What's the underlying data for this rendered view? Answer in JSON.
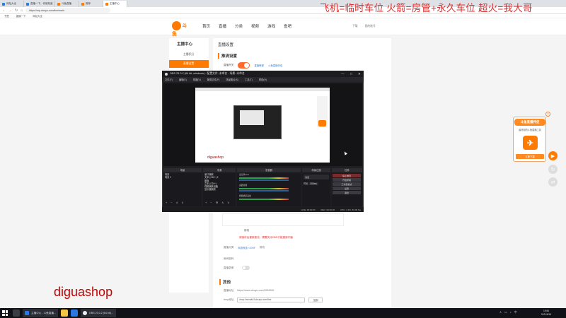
{
  "overlay_text": "飞机=临时车位  火箭=房管+永久车位  超火=我大哥",
  "watermark": "diguashop",
  "browser": {
    "tabs": [
      {
        "label": "网站大全",
        "active": false
      },
      {
        "label": "直播一下，你就知道",
        "active": false
      },
      {
        "label": "斗鱼直播",
        "active": false
      },
      {
        "label": "推荐",
        "active": false
      },
      {
        "label": "主播中心",
        "active": true
      }
    ],
    "url": "https://mp.douyu.com/live/main",
    "bookmarks": [
      "书签",
      "直播一下",
      "网站大全"
    ]
  },
  "site": {
    "logo_text": "斗鱼",
    "nav": [
      "首页",
      "直播",
      "分类",
      "视频",
      "游戏",
      "鱼吧"
    ],
    "user_links": [
      "下载",
      "我的账号"
    ]
  },
  "sidebar": {
    "title": "主播中心",
    "items": [
      {
        "label": "主播积分",
        "active": false
      },
      {
        "label": "直播设置",
        "active": true
      }
    ]
  },
  "main": {
    "title": "直播设置",
    "section_live": "推流设置",
    "open_label": "直播开关",
    "open_on": true,
    "link_tutorial": "直播教程",
    "link_tool": "斗鱼直播伴侣",
    "edit_button": "修改",
    "red_note": "请保存后重新推流，需要关闭OBS才能重新开播",
    "category_label": "直播分类",
    "category_value": "网游竞技>>DNF",
    "category_change": "修改",
    "password_label": "房间密码",
    "record_label": "直播录像",
    "section_other": "其他",
    "room_addr_label": "直播地址",
    "room_addr_value": "https://www.douyu.com/9999999",
    "rtmp_label": "rtmp地址",
    "rtmp_value": "rtmp://sendtc3.douyu.com/live",
    "copy_label": "复制"
  },
  "ad": {
    "title": "斗鱼直播伴侣",
    "subtitle": "最好用的斗鱼直播工具",
    "logo_glyph": "✈",
    "button": "立即下载"
  },
  "obs": {
    "title": "OBS 23.0.2 (64 bit, windows) - 配置文件: 未命名 - 场景: 未命名",
    "window_controls": [
      "—",
      "□",
      "✕"
    ],
    "menu": [
      "文件(F)",
      "编辑(E)",
      "视图(V)",
      "配置文件(P)",
      "场景集合(S)",
      "工具(T)",
      "帮助(H)"
    ],
    "inner_watermark": "diguashop",
    "docks": {
      "scenes": {
        "title": "场景",
        "items": [
          "场景",
          "场景 2"
        ]
      },
      "sources": {
        "title": "来源",
        "items": [
          "窗口捕获",
          "文本 (GDI+) 2",
          "图像",
          "文本 (GDI+)",
          "视频捕获设备",
          "显示器捕获"
        ]
      },
      "mixer": {
        "title": "混音器",
        "channels": [
          "麦克风/Aux",
          "桌面音频",
          "视频捕获设备"
        ]
      },
      "transitions": {
        "title": "场景过渡",
        "type": "淡出",
        "duration_label": "时长",
        "duration": "300ms"
      },
      "controls": {
        "title": "控件",
        "buttons": [
          "停止推流",
          "开始录制",
          "工作室模式",
          "设置",
          "退出"
        ]
      }
    },
    "status": {
      "live": "LIVE: 00:00:00",
      "rec": "REC: 00:00:00",
      "cpu": "CPU: 1.3%, 60.00 fps"
    }
  },
  "taskbar": {
    "items": [
      "主播中心 - 斗鱼直播...",
      "OBS 23.0.2 (64 bit)..."
    ],
    "time": "19:56",
    "date": "2021/6/16"
  }
}
